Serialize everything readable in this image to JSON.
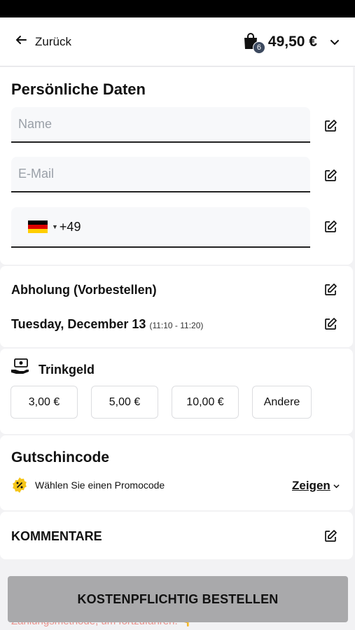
{
  "header": {
    "back_label": "Zurück",
    "cart_count": "6",
    "cart_total": "49,50 €"
  },
  "personal": {
    "title": "Persönliche Daten",
    "name_placeholder": "Name",
    "email_placeholder": "E-Mail",
    "phone_prefix": "+49"
  },
  "pickup": {
    "title": "Abholung (Vorbestellen)",
    "date": "Tuesday, December 13",
    "time": "(11:10 - 11:20)"
  },
  "tip": {
    "title": "Trinkgeld",
    "options": [
      "3,00 €",
      "5,00 €",
      "10,00 €",
      "Andere"
    ]
  },
  "voucher": {
    "title": "Gutschincode",
    "prompt": "Wählen Sie einen Promocode",
    "show_label": "Zeigen"
  },
  "comments": {
    "title": "KOMMENTARE"
  },
  "footer": {
    "hint": "Zahlungsmethode, um fortzufahren. 👇",
    "order_button": "KOSTENPFLICHTIG BESTELLEN"
  },
  "colors": {
    "order_button_bg": "#a9a9ab",
    "hint_text": "#e8908a",
    "badge_bg": "#3d4a5f",
    "promo_badge": "#f5c518"
  }
}
